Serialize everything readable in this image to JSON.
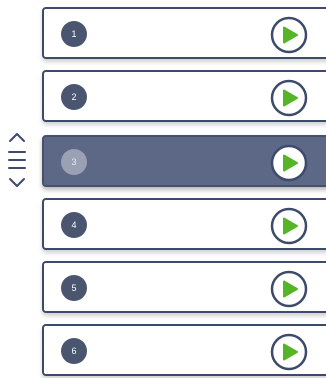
{
  "reorder_handle": {
    "icon": "reorder-handle-icon"
  },
  "rows": [
    {
      "number": "1",
      "play_icon": "play-icon",
      "selected": false
    },
    {
      "number": "2",
      "play_icon": "play-icon",
      "selected": false
    },
    {
      "number": "3",
      "play_icon": "play-icon",
      "selected": true
    },
    {
      "number": "4",
      "play_icon": "play-icon",
      "selected": false
    },
    {
      "number": "5",
      "play_icon": "play-icon",
      "selected": false
    },
    {
      "number": "6",
      "play_icon": "play-icon",
      "selected": false
    }
  ],
  "colors": {
    "border": "#3d4a6b",
    "badge": "#4a5570",
    "selected_background": "#5c6886",
    "play_green": "#55b527"
  }
}
